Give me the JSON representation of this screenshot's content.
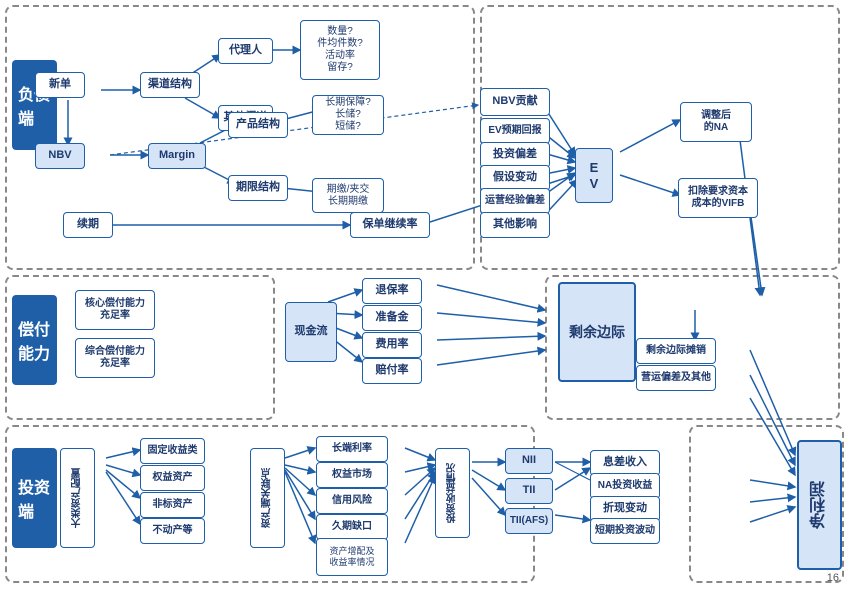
{
  "sections": {
    "liabilities": "负债端",
    "solvency": "偿付能力",
    "investment": "投资端",
    "surplus": "剩余边际",
    "profit": "净利润"
  },
  "boxes": {
    "xindan": "新单",
    "xuqi": "续期",
    "qudao": "渠道结构",
    "dailiren": "代理人",
    "qitaqudao": "其他渠道",
    "nbv": "NBV",
    "margin": "Margin",
    "chanpin": "产品结构",
    "qixian": "期限结构",
    "changqi": "长期保障?\n长储?\n短储?",
    "qixianfuji": "期缴/夹交\n长期期缴",
    "daili_detail": "数量?\n件均件数?\n活动率\n留存?",
    "nbv_gongxian": "NBV贡献",
    "ev_yuqi": "EV预期回报",
    "touzi_pianca": "投资偏差",
    "jiashe_biandong": "假设变动",
    "yunying_pianca": "运营经验偏差",
    "qita_yingxiang": "其他影响",
    "baoxian_jixulv": "保单继续率",
    "ev": "E\nV",
    "tiaozheng_na": "调整后\n的NA",
    "kouchu_vifb": "扣除要求资本\n成本的VIFB",
    "shengyu_bianjishao": "剩余边际摊销",
    "yingwun_pianca": "营运偏差及其他",
    "lixishouru": "息差收入",
    "na_touzi": "NA投资收益",
    "zhexian_biandong": "折现变动",
    "duanqi_biandong": "短期投资波动",
    "hexin_fuzhi": "核心偿付能力\n充足率",
    "zonghe_fuzhi": "综合偿付能力\n充足率",
    "xianjinliu": "现金流",
    "tuibao": "退保率",
    "zhunbeijin": "准备金",
    "feiyonglv": "费用率",
    "peifulv": "赔付率",
    "gudingshoulei": "固定收益类",
    "quanyi_zichan": "权益资产",
    "feibiao_zichan": "非标资产",
    "budongchan": "不动产等",
    "dalei_peizhi": "大类资产配置",
    "changyuan_lilv": "长端利率",
    "quanyi_shichang": "权益市场",
    "xinyong_fengxian": "信用风险",
    "jiuqi_qukou": "久期缺口",
    "zichan_zengpei": "资产增配及\n收益率情况",
    "zichan_guanliandian": "资产端关联点",
    "touzi_shouyiqingkuang": "投资收益情况",
    "nii": "NII",
    "tii": "TII",
    "tii_afs": "TII(AFS)",
    "shengyu_bianjie": "剩余边际"
  },
  "page_number": "16"
}
